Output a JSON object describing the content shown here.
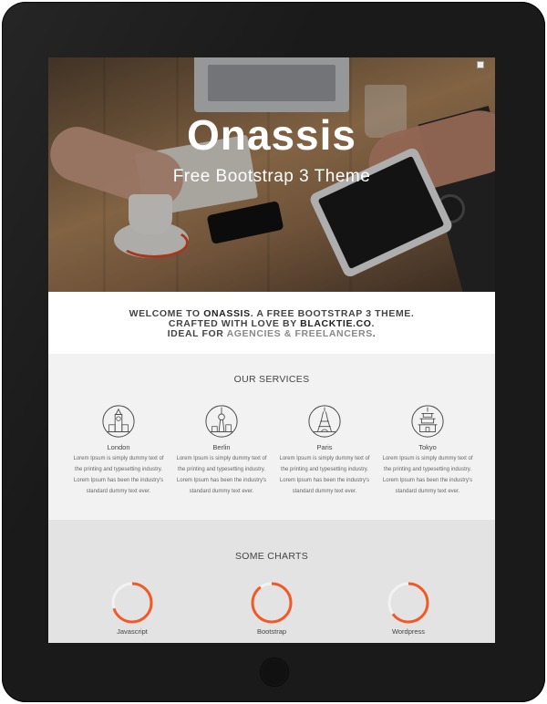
{
  "hero": {
    "title": "Onassis",
    "subtitle": "Free Bootstrap 3 Theme"
  },
  "welcome": {
    "line1_pre": "WELCOME TO ",
    "line1_brand": "ONASSIS",
    "line1_post": ". A FREE BOOTSTRAP 3 THEME.",
    "line2_pre": "CRAFTED WITH LOVE BY ",
    "line2_brand": "BLACKTIE.CO",
    "line2_post": ".",
    "line3_pre": "IDEAL FOR ",
    "line3_soft": "AGENCIES & FREELANCERS",
    "line3_post": "."
  },
  "services": {
    "title": "OUR SERVICES",
    "items": [
      {
        "name": "London",
        "icon": "big-ben-icon",
        "line1": "Lorem Ipsum is simply dummy text of",
        "line2": "the printing and typesetting industry.",
        "line3": "Lorem Ipsum has been the industry's",
        "line4": "standard dummy text ever."
      },
      {
        "name": "Berlin",
        "icon": "tv-tower-icon",
        "line1": "Lorem Ipsum is simply dummy text of",
        "line2": "the printing and typesetting industry.",
        "line3": "Lorem Ipsum has been the industry's",
        "line4": "standard dummy text ever."
      },
      {
        "name": "Paris",
        "icon": "eiffel-tower-icon",
        "line1": "Lorem Ipsum is simply dummy text of",
        "line2": "the printing and typesetting industry.",
        "line3": "Lorem Ipsum has been the industry's",
        "line4": "standard dummy text ever."
      },
      {
        "name": "Tokyo",
        "icon": "pagoda-icon",
        "line1": "Lorem Ipsum is simply dummy text of",
        "line2": "the printing and typesetting industry.",
        "line3": "Lorem Ipsum has been the industry's",
        "line4": "standard dummy text ever."
      }
    ]
  },
  "charts": {
    "title": "SOME CHARTS",
    "accent": "#f05a28",
    "track": "#f2f2f2",
    "items": [
      {
        "label": "Javascript",
        "fraction": 0.7
      },
      {
        "label": "Bootstrap",
        "fraction": 0.9
      },
      {
        "label": "Wordpress",
        "fraction": 0.65
      }
    ]
  }
}
